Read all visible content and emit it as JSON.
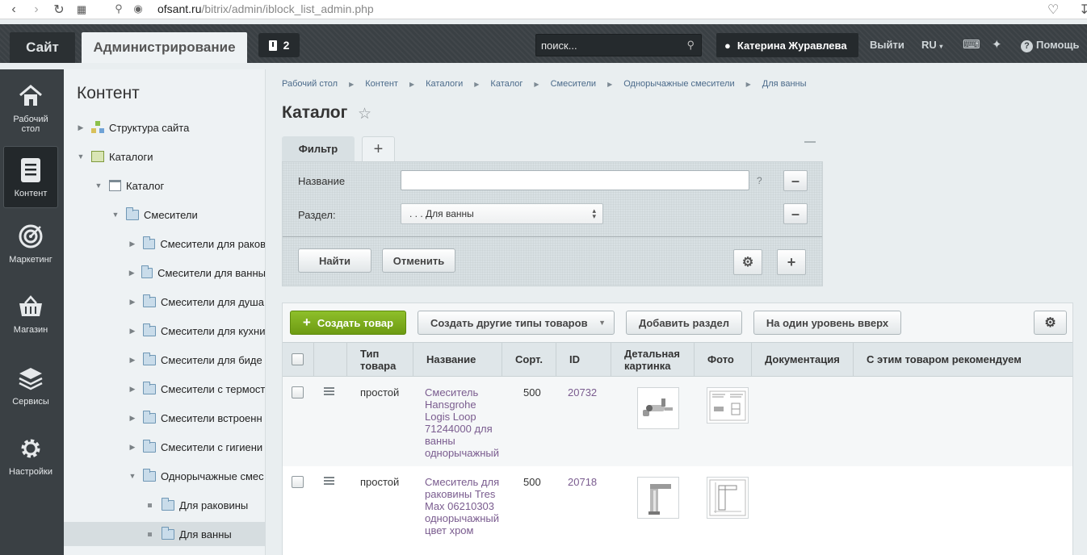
{
  "browser": {
    "url_host": "ofsant.ru",
    "url_path": "/bitrix/admin/iblock_list_admin.php"
  },
  "header": {
    "site_tab": "Сайт",
    "admin_tab": "Администрирование",
    "notifications_count": "2",
    "search_placeholder": "поиск...",
    "user_name": "Катерина Журавлева",
    "logout": "Выйти",
    "language": "RU",
    "help": "Помощь"
  },
  "left_menu": [
    {
      "label": "Рабочий стол",
      "icon": "home-icon"
    },
    {
      "label": "Контент",
      "icon": "document-icon",
      "active": true
    },
    {
      "label": "Маркетинг",
      "icon": "target-icon"
    },
    {
      "label": "Магазин",
      "icon": "basket-icon"
    },
    {
      "label": "Сервисы",
      "icon": "layers-icon"
    },
    {
      "label": "Настройки",
      "icon": "gear-icon"
    }
  ],
  "tree": {
    "title": "Контент",
    "items": [
      {
        "label": "Структура сайта"
      },
      {
        "label": "Каталоги"
      },
      {
        "label": "Каталог"
      },
      {
        "label": "Смесители"
      },
      {
        "label": "Смесители для раков"
      },
      {
        "label": "Смесители для ванны"
      },
      {
        "label": "Смесители для душа"
      },
      {
        "label": "Смесители для кухни"
      },
      {
        "label": "Смесители для биде"
      },
      {
        "label": "Смесители с термост"
      },
      {
        "label": "Смесители встроенн"
      },
      {
        "label": "Смесители с гигиени"
      },
      {
        "label": "Однорычажные смес"
      },
      {
        "label": "Для раковины"
      },
      {
        "label": "Для ванны"
      }
    ]
  },
  "breadcrumb": [
    "Рабочий стол",
    "Контент",
    "Каталоги",
    "Каталог",
    "Смесители",
    "Однорычажные смесители",
    "Для ванны"
  ],
  "page_title": "Каталог",
  "filter": {
    "tab_label": "Фильтр",
    "name_label": "Название",
    "name_value": "",
    "help_mark": "?",
    "section_label": "Раздел:",
    "section_value": ". . . Для ванны",
    "find_button": "Найти",
    "cancel_button": "Отменить"
  },
  "toolbar": {
    "create_product": "Создать товар",
    "create_other": "Создать другие типы товаров",
    "add_section": "Добавить раздел",
    "level_up": "На один уровень вверх"
  },
  "table": {
    "columns": [
      "Тип товара",
      "Название",
      "Сорт.",
      "ID",
      "Детальная картинка",
      "Фото",
      "Документация",
      "С этим товаром рекомендуем"
    ],
    "rows": [
      {
        "type": "простой",
        "name": "Смеситель Hansgrohe Logis Loop 71244000 для ванны однорычажный",
        "sort": "500",
        "id": "20732"
      },
      {
        "type": "простой",
        "name": "Смеситель для раковины Tres Max 06210303 однорычажный цвет хром",
        "sort": "500",
        "id": "20718"
      }
    ]
  },
  "colors": {
    "header_bg": "#3a4044",
    "accent_green": "#7aab1d",
    "link_purple": "#7a5c8f"
  }
}
